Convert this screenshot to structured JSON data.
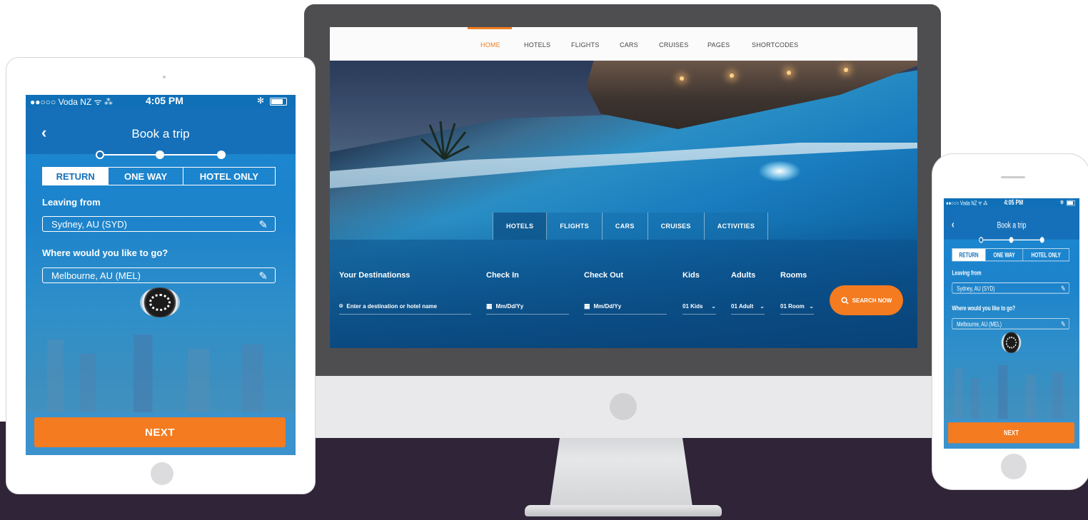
{
  "desktop": {
    "nav": [
      "HOME",
      "HOTELS",
      "FLIGHTS",
      "CARS",
      "CRUISES",
      "PAGES",
      "SHORTCODES"
    ],
    "tabs": [
      "HOTELS",
      "FLIGHTS",
      "CARS",
      "CRUISES",
      "ACTIVITIES"
    ],
    "fields": {
      "destination_label": "Your Destinationss",
      "destination_placeholder": "Enter a destination or hotel name",
      "checkin_label": "Check In",
      "checkin_placeholder": "Mm/Dd/Yy",
      "checkout_label": "Check Out",
      "checkout_placeholder": "Mm/Dd/Yy",
      "kids_label": "Kids",
      "kids_value": "01 Kids",
      "adults_label": "Adults",
      "adults_value": "01 Adult",
      "rooms_label": "Rooms",
      "rooms_value": "01 Room"
    },
    "search_button": "SEARCH NOW",
    "accent": "#ef7d22"
  },
  "mobile_app": {
    "status": {
      "carrier": "●●○○○ Voda NZ ᯤ ⁂",
      "time": "4:05 PM",
      "bt": "✻"
    },
    "title": "Book a trip",
    "segments": [
      "RETURN",
      "ONE WAY",
      "HOTEL ONLY"
    ],
    "leaving_label": "Leaving from",
    "leaving_value": "Sydney, AU (SYD)",
    "dest_label": "Where would you like to go?",
    "dest_value": "Melbourne, AU (MEL)",
    "next_button": "NEXT",
    "accent": "#f47b20"
  }
}
